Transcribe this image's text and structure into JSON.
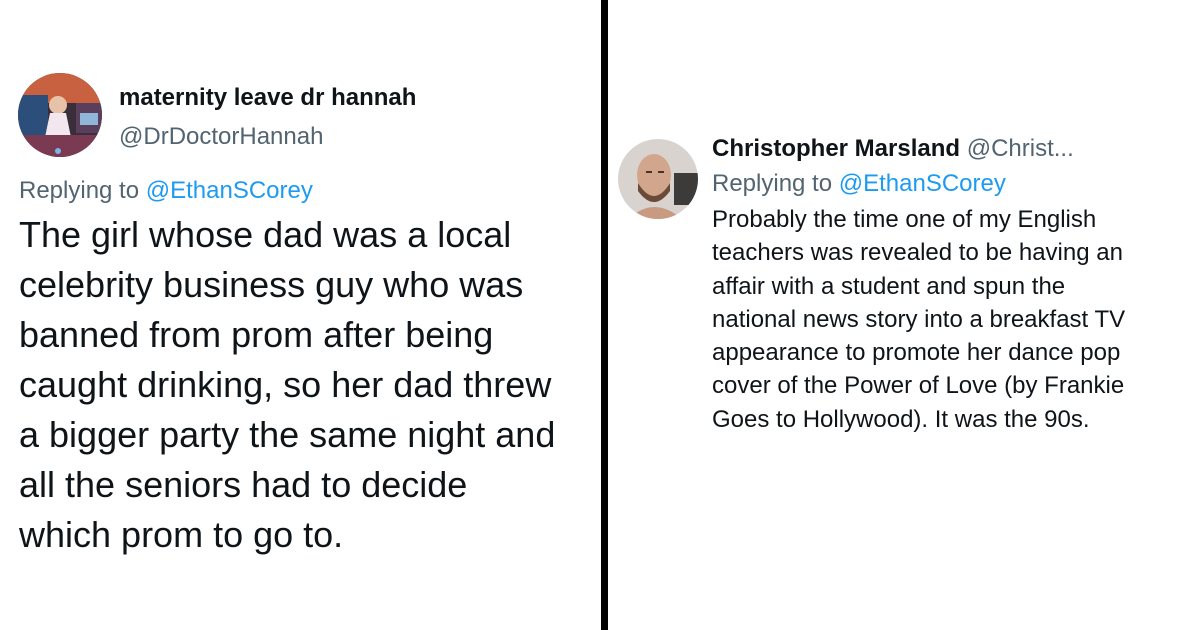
{
  "left_tweet": {
    "display_name": "maternity leave dr hannah",
    "handle": "@DrDoctorHannah",
    "replying_prefix": "Replying to ",
    "replying_to": "@EthanSCorey",
    "body_lines": [
      "The girl whose dad was a local",
      "celebrity business guy who was",
      "banned from prom after being",
      "caught drinking, so her dad threw",
      "a bigger party the same night and",
      "all the seniors had to decide",
      "which prom to go to."
    ]
  },
  "right_tweet": {
    "display_name": "Christopher Marsland",
    "handle": "@Christ...",
    "replying_prefix": "Replying to ",
    "replying_to": "@EthanSCorey",
    "body_lines": [
      "Probably the time one of my English",
      "teachers was revealed to be having an",
      "affair with a student and spun the",
      "national news story into a breakfast TV",
      "appearance to promote her dance pop",
      "cover of the Power of Love (by Frankie",
      "Goes to Hollywood). It was the 90s."
    ]
  },
  "colors": {
    "text_primary": "#0f1419",
    "text_secondary": "#536471",
    "mention": "#1d9bf0",
    "divider": "#000000"
  }
}
